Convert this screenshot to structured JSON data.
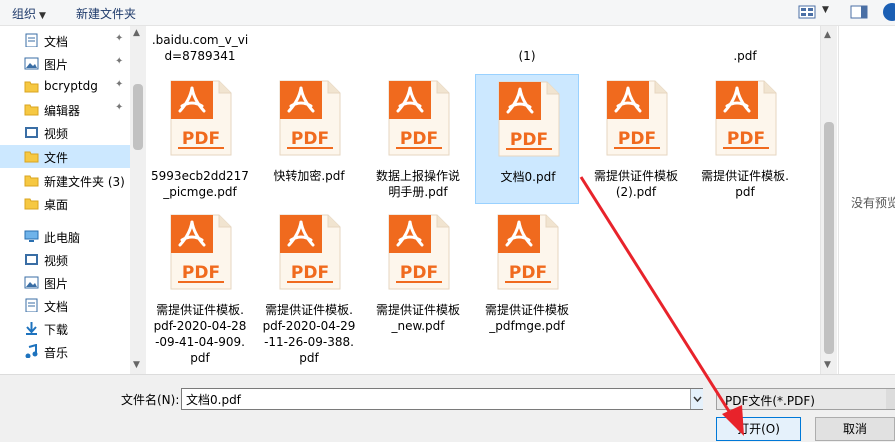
{
  "toolbar": {
    "organize": "组织",
    "new_folder": "新建文件夹"
  },
  "nav": {
    "items": [
      {
        "label": "文档",
        "icon": "document-icon",
        "pinned": true
      },
      {
        "label": "图片",
        "icon": "picture-icon",
        "pinned": true
      },
      {
        "label": "bcryptdg",
        "icon": "folder-icon",
        "pinned": true
      },
      {
        "label": "编辑器",
        "icon": "folder-icon",
        "pinned": true
      },
      {
        "label": "视频",
        "icon": "video-icon",
        "pinned": false
      },
      {
        "label": "文件",
        "icon": "folder-icon",
        "pinned": false,
        "selected": true
      },
      {
        "label": "新建文件夹 (3)",
        "icon": "folder-icon",
        "pinned": false
      },
      {
        "label": "桌面",
        "icon": "folder-icon",
        "pinned": false
      },
      {
        "label": "此电脑",
        "icon": "computer-icon",
        "pinned": false
      },
      {
        "label": "视频",
        "icon": "video-icon",
        "pinned": false
      },
      {
        "label": "图片",
        "icon": "picture-icon",
        "pinned": false
      },
      {
        "label": "文档",
        "icon": "document-icon",
        "pinned": false
      },
      {
        "label": "下载",
        "icon": "download-icon",
        "pinned": false
      },
      {
        "label": "音乐",
        "icon": "music-icon",
        "pinned": false
      }
    ]
  },
  "files": {
    "top_row_partial": [
      ".baidu.com_v_vi\nd=8789341",
      "",
      "",
      "(1)",
      "",
      ".pdf"
    ],
    "row1": [
      "5993ecb2dd217\n_picmge.pdf",
      "快转加密.pdf",
      "数据上报操作说\n明手册.pdf",
      "文档0.pdf",
      "需提供证件模板\n(2).pdf",
      "需提供证件模板.\npdf"
    ],
    "row2": [
      "需提供证件模板.\npdf-2020-04-28\n-09-41-04-909.\npdf",
      "需提供证件模板.\npdf-2020-04-29\n-11-26-09-388.\npdf",
      "需提供证件模板\n_new.pdf",
      "需提供证件模板\n_pdfmge.pdf"
    ],
    "selected": "文档0.pdf",
    "thumbnail_text": "PDF"
  },
  "preview": {
    "text": "没有预览"
  },
  "bottom": {
    "filename_label": "文件名(N):",
    "filename_value": "文档0.pdf",
    "filetype_value": "PDF文件(*.PDF)",
    "open_label": "打开(O)",
    "cancel_label": "取消"
  },
  "colors": {
    "accent": "#cce8ff",
    "pdf_orange": "#f06a1e",
    "annotation_arrow": "#e8232b"
  }
}
